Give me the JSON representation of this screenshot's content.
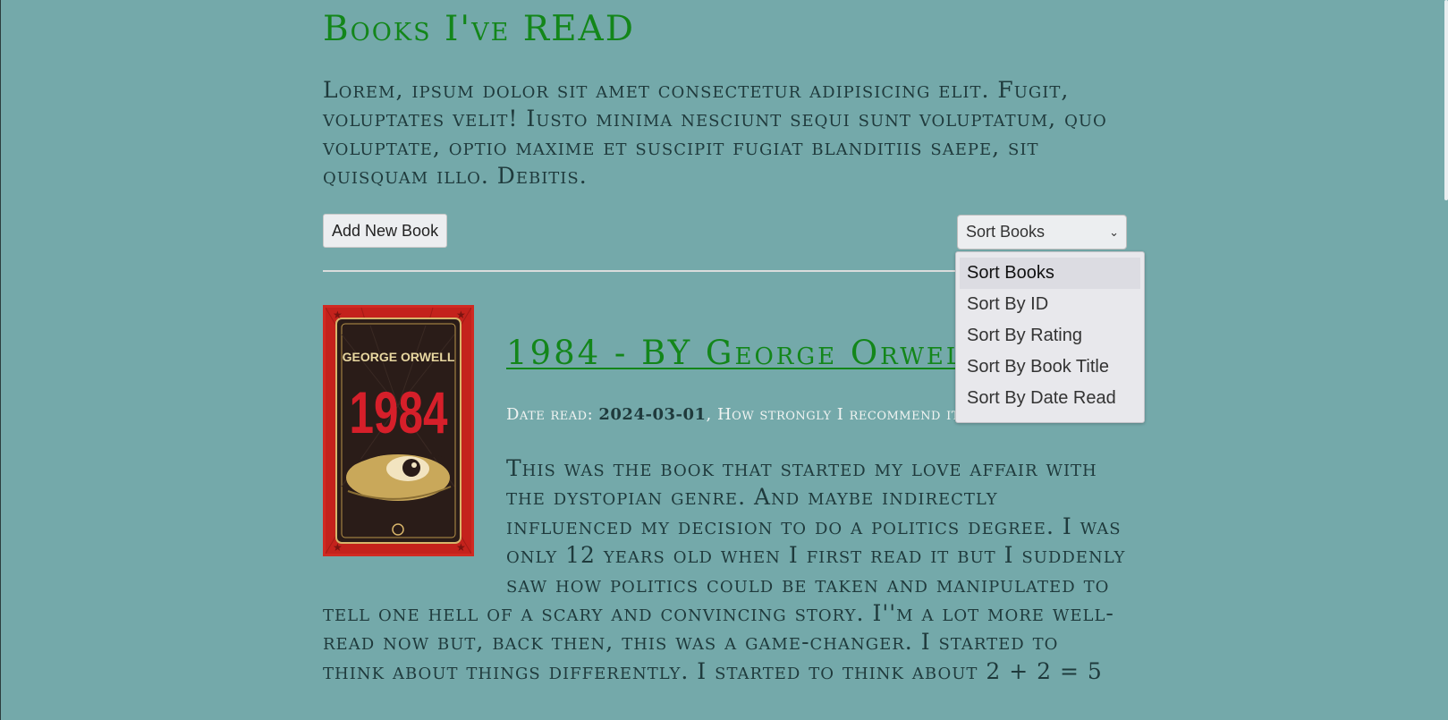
{
  "header": {
    "title": "Books I've READ",
    "intro": "Lorem, ipsum dolor sit amet consectetur adipisicing elit. Fugit, voluptates velit! Iusto minima nesciunt sequi sunt voluptatum, quo voluptate, optio maxime et suscipit fugiat blanditiis saepe, sit quisquam illo. Debitis."
  },
  "toolbar": {
    "add_button_label": "Add New Book",
    "sort_selected": "Sort Books",
    "sort_options": [
      "Sort Books",
      "Sort By ID",
      "Sort By Rating",
      "Sort By Book Title",
      "Sort By Date Read"
    ]
  },
  "book": {
    "title": "1984 - BY George Orwell",
    "cover": {
      "author_text": "GEORGE ORWELL",
      "title_text": "1984"
    },
    "date_read_label": "Date read: ",
    "date_read": "2024-03-01",
    "recommend_label": ", How strongly I recommend it: ",
    "review": "This was the book that started my love affair with the dystopian genre. And maybe indirectly influenced my decision to do a politics degree. I was only 12 years old when I first read it but I suddenly saw how politics could be taken and manipulated to tell one hell of a scary and convincing story. I''m a lot more well-read now but, back then, this was a game-changer. I started to think about things differently. I started to think about 2 + 2 = 5"
  },
  "colors": {
    "background": "#74a9aa",
    "accent_green": "#13861a",
    "text_dark": "#1f3a3c"
  },
  "icons": {
    "sort_chevron": "chevron-down-icon"
  }
}
